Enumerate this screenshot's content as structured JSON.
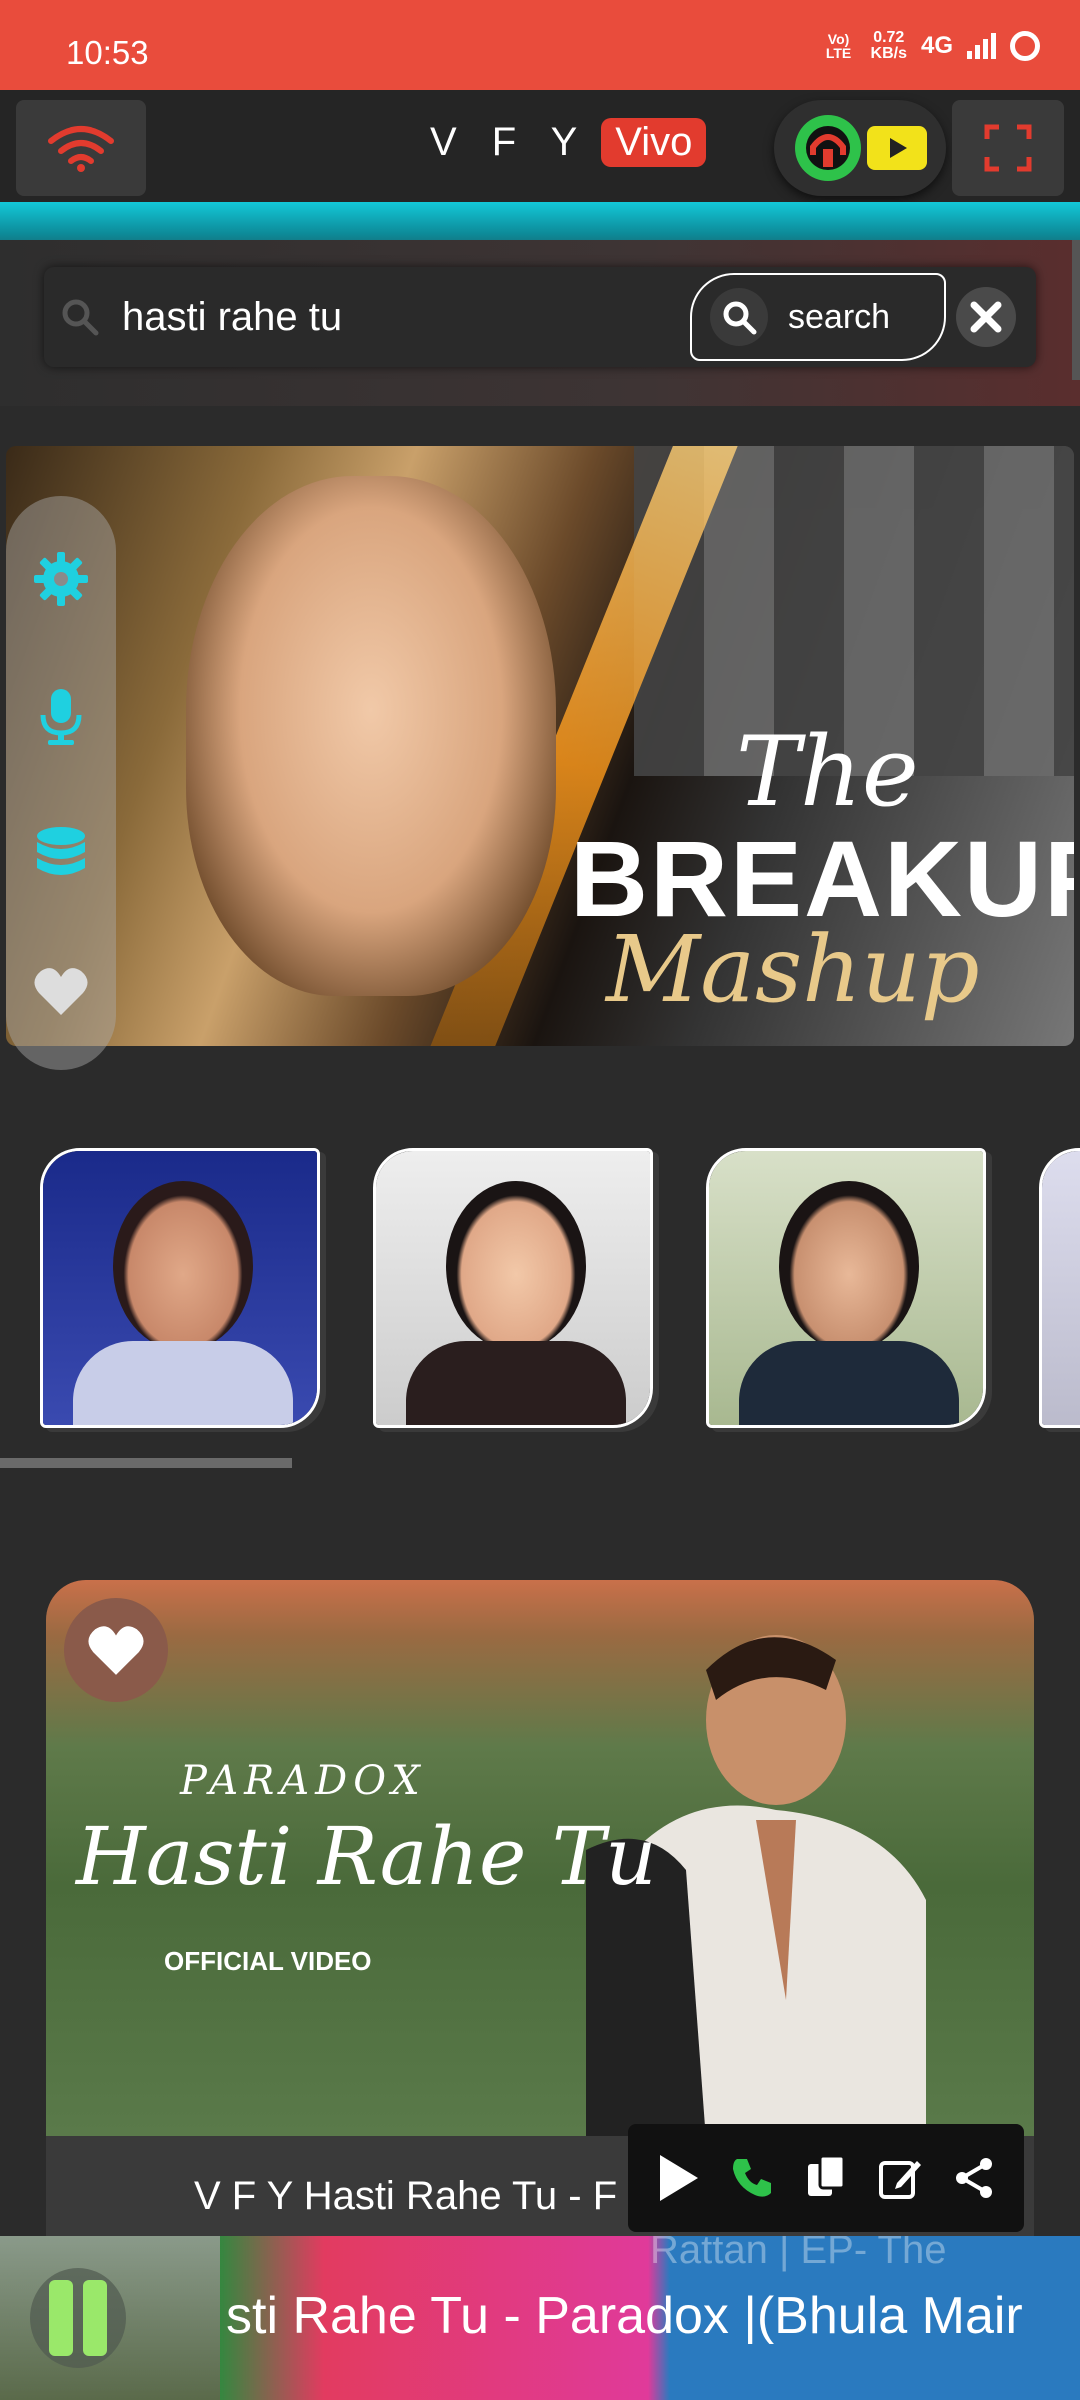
{
  "status_bar": {
    "time": "10:53",
    "volte": "Vo) LTE",
    "speed_value": "0.72",
    "speed_unit": "KB/s",
    "network": "4G"
  },
  "app_bar": {
    "brand_text": "V F Y",
    "brand_badge": "Vivo",
    "accent_color": "#e23b2e"
  },
  "search": {
    "value": "hasti rahe tu",
    "button_label": "search"
  },
  "banner": {
    "line1": "The",
    "line2": "BREAKUP",
    "line3": "Mashup"
  },
  "side_panel": {
    "icons": [
      "gear-icon",
      "microphone-icon",
      "database-icon",
      "heart-icon"
    ],
    "icon_color": "#1fd0e0"
  },
  "artists": [
    {
      "name": "artist-1"
    },
    {
      "name": "artist-2"
    },
    {
      "name": "artist-3"
    },
    {
      "name": "artist-4"
    }
  ],
  "video_card": {
    "brand_overlay": "PARADOX",
    "thumb_title": "Hasti Rahe Tu",
    "thumb_sub": "OFFICIAL VIDEO",
    "caption": "V F Y Hasti Rahe Tu - F"
  },
  "mini_player": {
    "title": "sti Rahe Tu - Paradox |(Bhula Mair",
    "ghost_text": "Rattan | EP- The"
  }
}
